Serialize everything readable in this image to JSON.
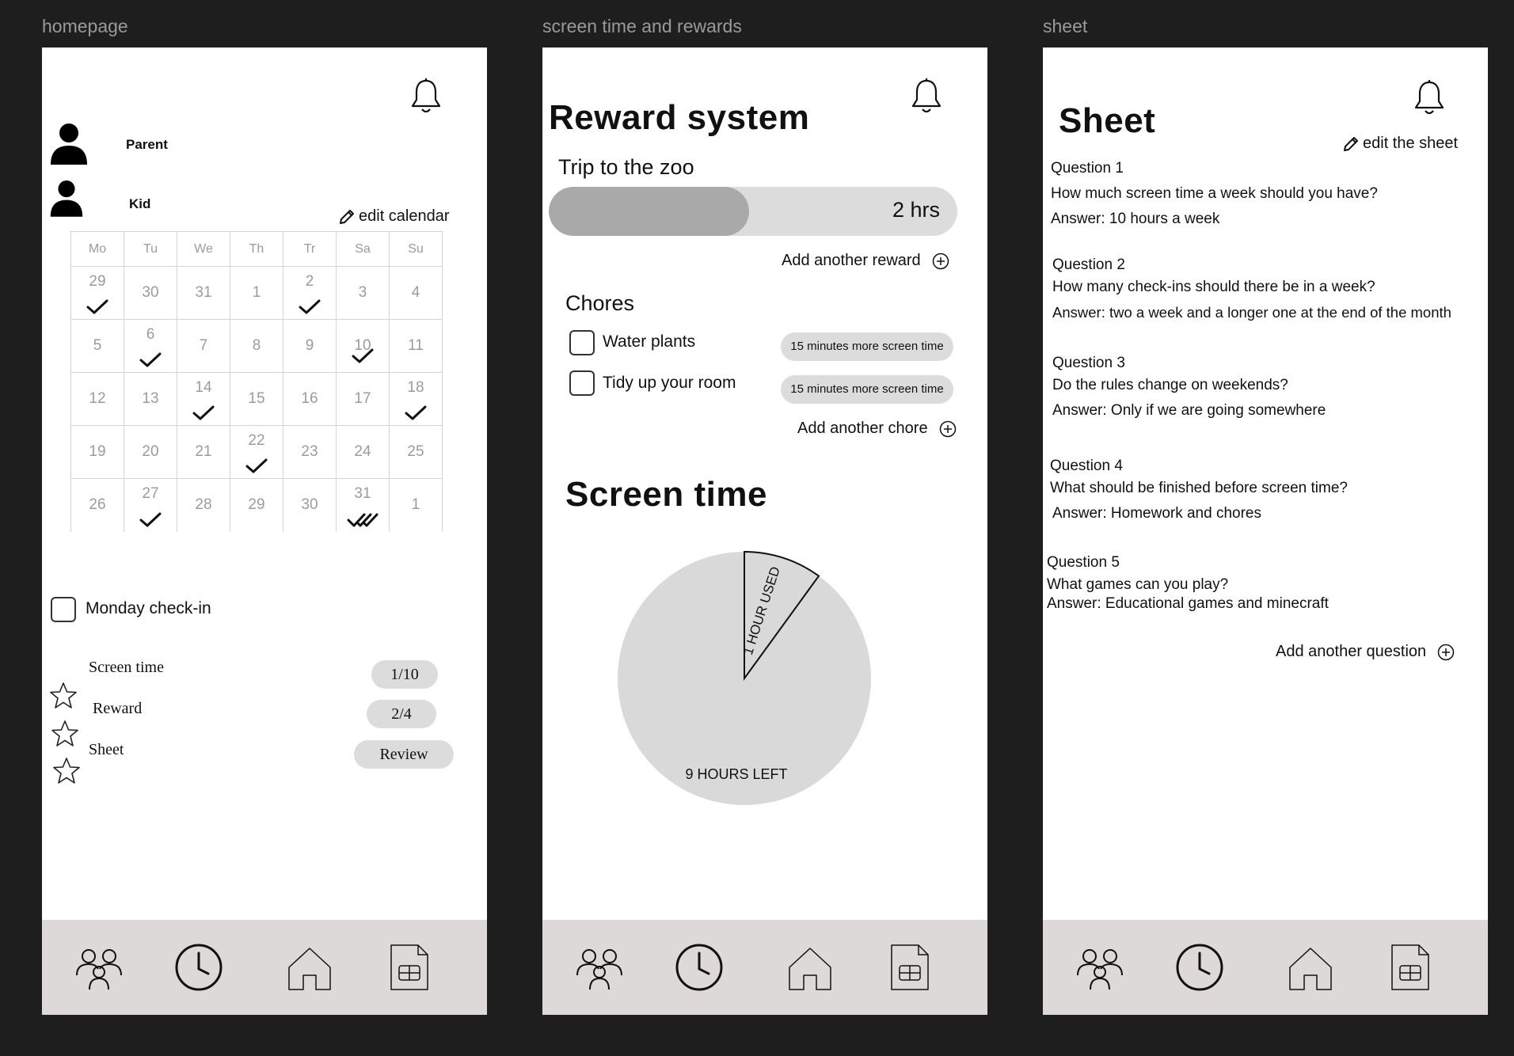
{
  "frames": {
    "homepage": "homepage",
    "rewards": "screen time and rewards",
    "sheet": "sheet"
  },
  "home": {
    "parent": "Parent",
    "kid": "Kid",
    "edit_calendar": "edit calendar",
    "weekdays": [
      "Mo",
      "Tu",
      "We",
      "Th",
      "Tr",
      "Sa",
      "Su"
    ],
    "weeks": [
      [
        "29",
        "30",
        "31",
        "1",
        "2",
        "3",
        "4"
      ],
      [
        "5",
        "6",
        "7",
        "8",
        "9",
        "10",
        "11"
      ],
      [
        "12",
        "13",
        "14",
        "15",
        "16",
        "17",
        "18"
      ],
      [
        "19",
        "20",
        "21",
        "22",
        "23",
        "24",
        "25"
      ],
      [
        "26",
        "27",
        "28",
        "29",
        "30",
        "31",
        "1"
      ]
    ],
    "monday_checkin": "Monday check-in",
    "screen_time": "Screen time",
    "reward": "Reward",
    "sheet": "Sheet",
    "screen_time_value": "1/10",
    "reward_value": "2/4",
    "review": "Review"
  },
  "rewards": {
    "title": "Reward system",
    "reward_name": "Trip to the zoo",
    "reward_progress": 0.49,
    "reward_hours": "2 hrs",
    "add_reward": "Add another reward",
    "chores_title": "Chores",
    "chores": [
      {
        "label": "Water plants",
        "bonus": "15 minutes more screen time"
      },
      {
        "label": "Tidy up your room",
        "bonus": "15 minutes more screen time"
      }
    ],
    "add_chore": "Add another chore",
    "screen_time_title": "Screen time",
    "used_label": "1 HOUR USED",
    "left_label": "9 HOURS LEFT",
    "used_hours": 1,
    "total_hours": 10
  },
  "sheet": {
    "title": "Sheet",
    "edit": "edit the sheet",
    "questions": [
      {
        "label": "Question 1",
        "question": "How much screen time a week should you have?",
        "answer": "Answer: 10 hours a week"
      },
      {
        "label": "Question 2",
        "question": "How many check-ins should there be in a week?",
        "answer": "Answer: two a week and a longer one at the end of the month"
      },
      {
        "label": "Question 3",
        "question": "Do the rules change on weekends?",
        "answer": "Answer: Only if we are going somewhere"
      },
      {
        "label": "Question 4",
        "question": "What should be finished before screen time?",
        "answer": "Answer: Homework and chores"
      },
      {
        "label": "Question 5",
        "question": "What games can you play?",
        "answer": "Answer: Educational games and minecraft"
      }
    ],
    "add_question": "Add another question"
  },
  "icons": {
    "bell": "bell-icon",
    "family": "family-icon",
    "clock": "clock-icon",
    "home": "home-icon",
    "sheet": "spreadsheet-icon",
    "star": "star-icon",
    "check": "check-icon",
    "double_check": "double-check-icon",
    "pencil": "pencil-icon",
    "plus": "plus-circle-icon"
  }
}
